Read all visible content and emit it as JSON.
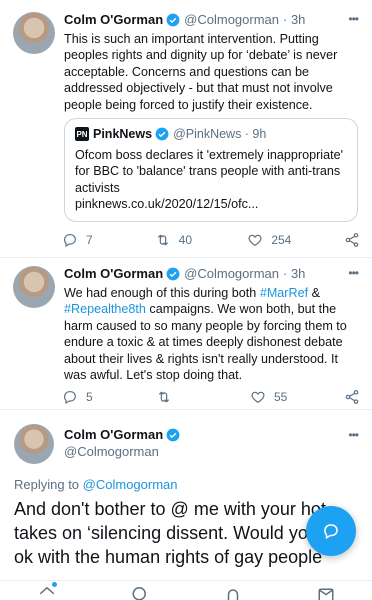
{
  "tweets": [
    {
      "name": "Colm O'Gorman",
      "handle": "@Colmogorman",
      "time": "· 3h",
      "text": "This is such an important intervention. Putting peoples rights and dignity up for ‘debate’ is never acceptable. Concerns and questions can be addressed objectively - but that must not involve people being forced to justify their existence.",
      "quote": {
        "logo": "PN",
        "name": "PinkNews",
        "handle": "@PinkNews · 9h",
        "text": "Ofcom boss declares it 'extremely inappropriate' for BBC to 'balance' trans people with anti-trans activists",
        "link": "pinknews.co.uk/2020/12/15/ofc..."
      },
      "replies": "7",
      "retweets": "40",
      "likes": "254"
    },
    {
      "name": "Colm O'Gorman",
      "handle": "@Colmogorman",
      "time": "· 3h",
      "text_before": "We had enough of this during both ",
      "hashtag1": "#MarRef",
      "text_mid": " & ",
      "hashtag2": "#Repealthe8th",
      "text_after": " campaigns. We won both, but the harm caused to so many people by forcing them to endure a toxic & at times deeply dishonest debate about their lives & rights isn't really understood. It was awful. Let's stop doing that.",
      "replies": "5",
      "retweets": "",
      "likes": "55"
    },
    {
      "name": "Colm O'Gorman",
      "handle": "@Colmogorman"
    }
  ],
  "reply_prefix": "Replying to ",
  "reply_handle": "@Colmogorman",
  "main_text": "And don't bother to @ me with your hot takes on ‘silencing dissent. Would you be ok with the human rights of gay people",
  "more_label": "•••",
  "colors": {
    "accent": "#1da1f2",
    "muted": "#5b7083",
    "text": "#0f1419"
  },
  "icons": [
    "verified-icon",
    "reply-icon",
    "retweet-icon",
    "like-icon",
    "share-icon",
    "compose-icon",
    "home-icon",
    "search-icon",
    "notifications-icon",
    "messages-icon"
  ]
}
